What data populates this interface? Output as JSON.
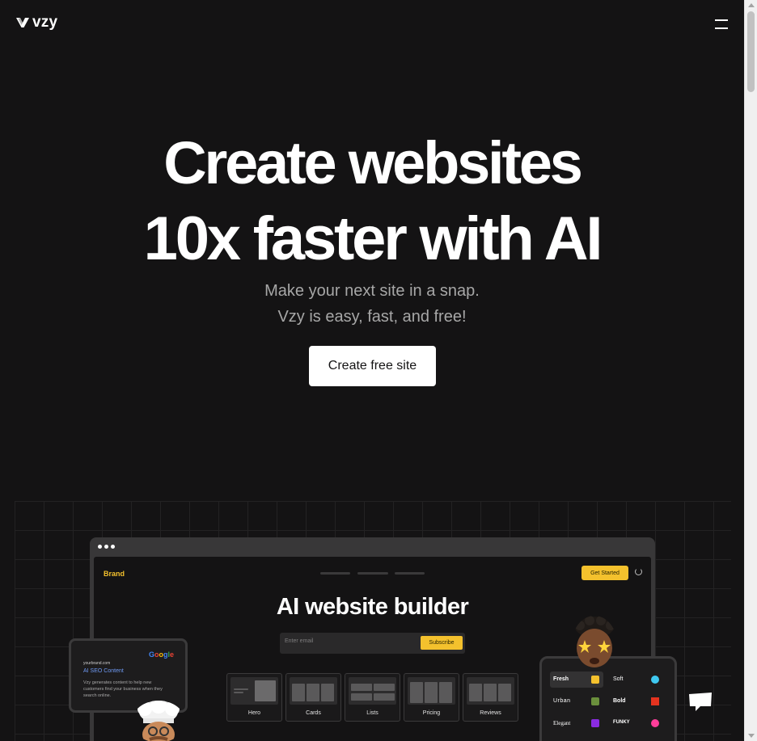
{
  "header": {
    "brand": "vzy",
    "menu_icon": "hamburger-icon"
  },
  "hero": {
    "title_line1": "Create websites",
    "title_line2": "10x faster with AI",
    "subtitle_line1": "Make your next site in a snap.",
    "subtitle_line2": "Vzy is easy, fast, and free!",
    "cta_label": "Create free site"
  },
  "mockup": {
    "brand": "Brand",
    "get_started": "Get Started",
    "title": "AI website builder",
    "email_placeholder": "Enter email",
    "subscribe": "Subscribe",
    "sections": [
      "Hero",
      "Cards",
      "Lists",
      "Pricing",
      "Reviews"
    ]
  },
  "google_card": {
    "logo_text": "Google",
    "url": "yourbrand.com",
    "heading": "AI SEO Content",
    "description": "Vzy generates content to help new customers find your business when they search online."
  },
  "themes": [
    {
      "name": "Fresh",
      "color": "#f4c12d"
    },
    {
      "name": "Soft",
      "color": "#3fc8f0"
    },
    {
      "name": "Urban",
      "color": "#6a8f3c"
    },
    {
      "name": "Bold",
      "color": "#e4331f"
    },
    {
      "name": "Elegant",
      "color": "#8a2be2"
    },
    {
      "name": "FUNKY",
      "color": "#ff3e9a"
    }
  ],
  "colors": {
    "background": "#141314",
    "accent": "#f4c12d",
    "cta_bg": "#ffffff"
  },
  "chat_icon": "chat-bubble-icon"
}
